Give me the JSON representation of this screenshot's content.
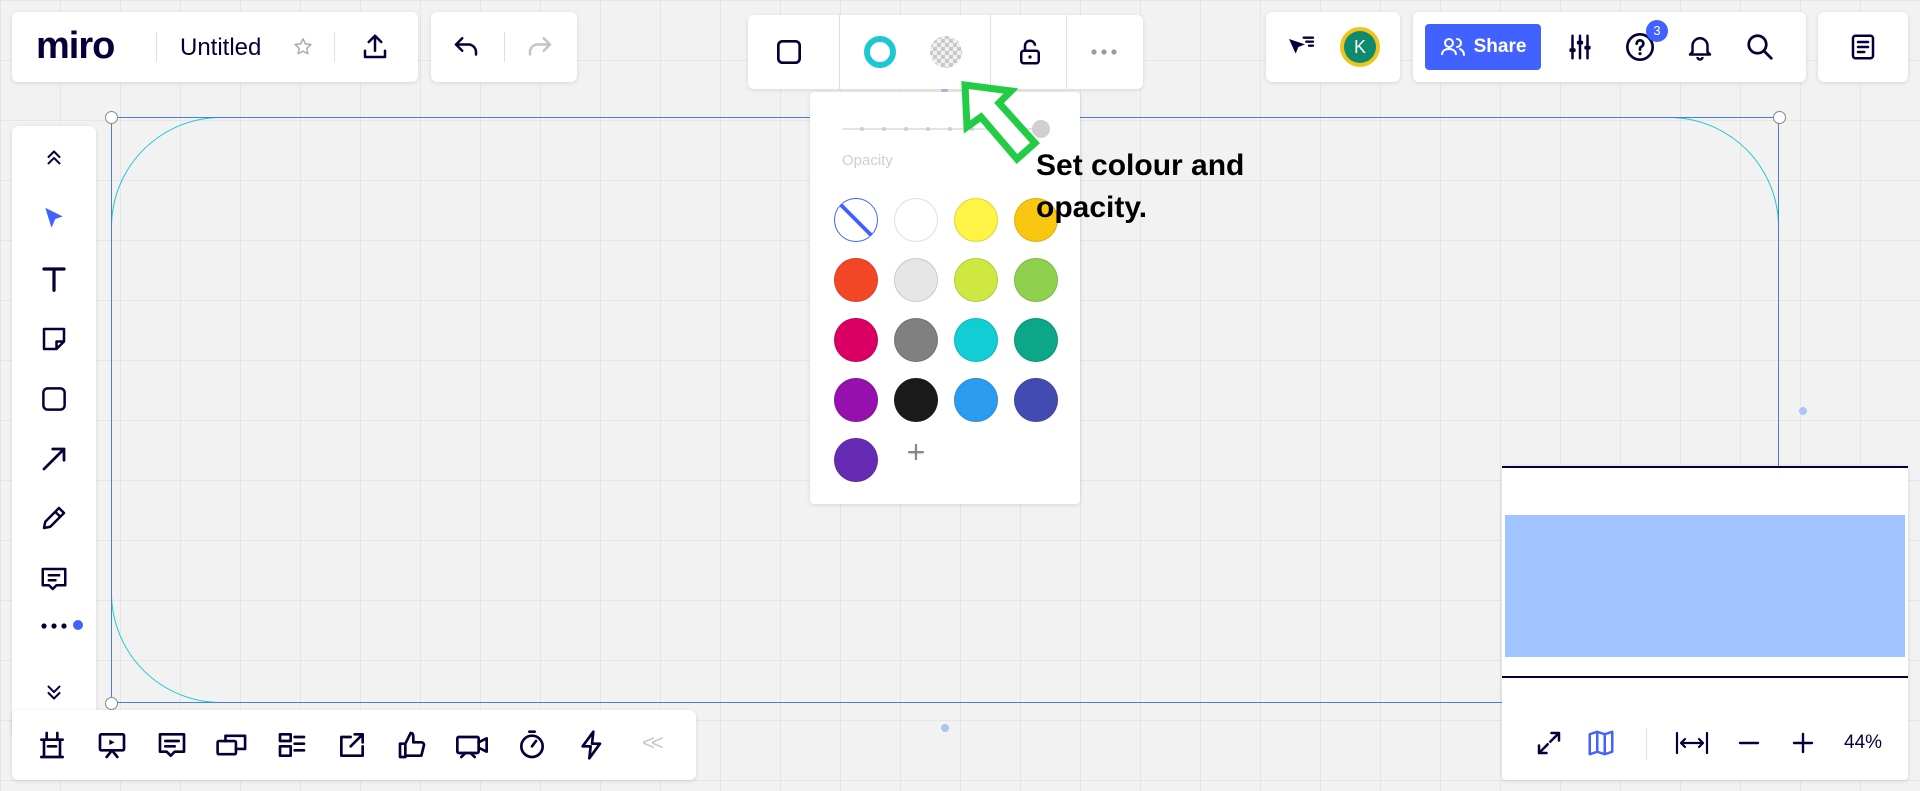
{
  "app": {
    "logo": "miro",
    "board_title": "Untitled"
  },
  "colors": {
    "accent": "#4262ff",
    "selection": "#4a7fe0",
    "shape_stroke": "#1ec8d0",
    "callout_arrow": "#22cc44"
  },
  "header_right": {
    "share_label": "Share",
    "avatar_initial": "K",
    "help_badge": "3"
  },
  "context_toolbar": {
    "icons": [
      "shape-icon",
      "stroke-color-icon",
      "fill-color-icon",
      "lock-icon",
      "more-icon"
    ]
  },
  "color_picker": {
    "opacity_label": "Opacity",
    "opacity_value": 1.0,
    "swatches": [
      {
        "name": "transparent",
        "color": "transparent"
      },
      {
        "name": "white",
        "color": "#ffffff"
      },
      {
        "name": "yellow",
        "color": "#fef445"
      },
      {
        "name": "amber",
        "color": "#fac710"
      },
      {
        "name": "red-orange",
        "color": "#f24726"
      },
      {
        "name": "light-gray",
        "color": "#e6e6e6"
      },
      {
        "name": "lime",
        "color": "#cee741"
      },
      {
        "name": "green",
        "color": "#8fd14f"
      },
      {
        "name": "magenta",
        "color": "#da0063"
      },
      {
        "name": "gray",
        "color": "#808080"
      },
      {
        "name": "cyan",
        "color": "#12cdd4"
      },
      {
        "name": "teal",
        "color": "#0ca789"
      },
      {
        "name": "purple",
        "color": "#9510ac"
      },
      {
        "name": "black",
        "color": "#1a1a1a"
      },
      {
        "name": "sky-blue",
        "color": "#2d9bf0"
      },
      {
        "name": "indigo",
        "color": "#414bb2"
      },
      {
        "name": "violet",
        "color": "#652cb3"
      }
    ],
    "add_label": "+"
  },
  "callout": {
    "text_line1": "Set colour and",
    "text_line2": "opacity."
  },
  "left_toolbar": {
    "tools": [
      "collapse-up-icon",
      "select-icon",
      "text-icon",
      "sticky-note-icon",
      "shape-icon",
      "arrow-icon",
      "pen-icon",
      "comment-icon",
      "more-tools-icon",
      "collapse-down-icon"
    ]
  },
  "bottom_toolbar": {
    "tools": [
      "frames-icon",
      "presentation-icon",
      "comments-icon",
      "cards-icon",
      "kanban-icon",
      "share-screen-icon",
      "voting-icon",
      "video-chat-icon",
      "timer-icon",
      "apps-icon"
    ],
    "collapse_label": "<<"
  },
  "zoom": {
    "level_label": "44%"
  }
}
